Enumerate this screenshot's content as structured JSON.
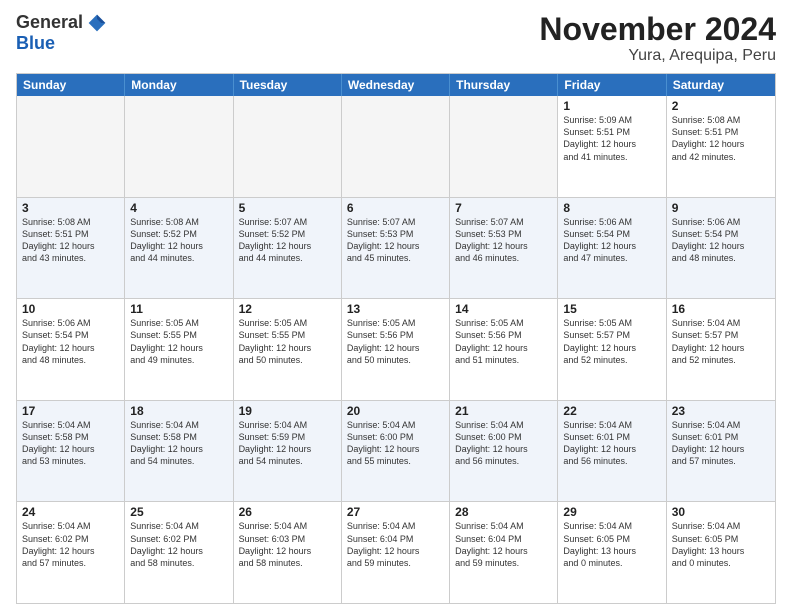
{
  "logo": {
    "general": "General",
    "blue": "Blue"
  },
  "title": "November 2024",
  "location": "Yura, Arequipa, Peru",
  "headers": [
    "Sunday",
    "Monday",
    "Tuesday",
    "Wednesday",
    "Thursday",
    "Friday",
    "Saturday"
  ],
  "rows": [
    [
      {
        "day": "",
        "empty": true
      },
      {
        "day": "",
        "empty": true
      },
      {
        "day": "",
        "empty": true
      },
      {
        "day": "",
        "empty": true
      },
      {
        "day": "",
        "empty": true
      },
      {
        "day": "1",
        "lines": [
          "Sunrise: 5:09 AM",
          "Sunset: 5:51 PM",
          "Daylight: 12 hours",
          "and 41 minutes."
        ]
      },
      {
        "day": "2",
        "lines": [
          "Sunrise: 5:08 AM",
          "Sunset: 5:51 PM",
          "Daylight: 12 hours",
          "and 42 minutes."
        ]
      }
    ],
    [
      {
        "day": "3",
        "lines": [
          "Sunrise: 5:08 AM",
          "Sunset: 5:51 PM",
          "Daylight: 12 hours",
          "and 43 minutes."
        ]
      },
      {
        "day": "4",
        "lines": [
          "Sunrise: 5:08 AM",
          "Sunset: 5:52 PM",
          "Daylight: 12 hours",
          "and 44 minutes."
        ]
      },
      {
        "day": "5",
        "lines": [
          "Sunrise: 5:07 AM",
          "Sunset: 5:52 PM",
          "Daylight: 12 hours",
          "and 44 minutes."
        ]
      },
      {
        "day": "6",
        "lines": [
          "Sunrise: 5:07 AM",
          "Sunset: 5:53 PM",
          "Daylight: 12 hours",
          "and 45 minutes."
        ]
      },
      {
        "day": "7",
        "lines": [
          "Sunrise: 5:07 AM",
          "Sunset: 5:53 PM",
          "Daylight: 12 hours",
          "and 46 minutes."
        ]
      },
      {
        "day": "8",
        "lines": [
          "Sunrise: 5:06 AM",
          "Sunset: 5:54 PM",
          "Daylight: 12 hours",
          "and 47 minutes."
        ]
      },
      {
        "day": "9",
        "lines": [
          "Sunrise: 5:06 AM",
          "Sunset: 5:54 PM",
          "Daylight: 12 hours",
          "and 48 minutes."
        ]
      }
    ],
    [
      {
        "day": "10",
        "lines": [
          "Sunrise: 5:06 AM",
          "Sunset: 5:54 PM",
          "Daylight: 12 hours",
          "and 48 minutes."
        ]
      },
      {
        "day": "11",
        "lines": [
          "Sunrise: 5:05 AM",
          "Sunset: 5:55 PM",
          "Daylight: 12 hours",
          "and 49 minutes."
        ]
      },
      {
        "day": "12",
        "lines": [
          "Sunrise: 5:05 AM",
          "Sunset: 5:55 PM",
          "Daylight: 12 hours",
          "and 50 minutes."
        ]
      },
      {
        "day": "13",
        "lines": [
          "Sunrise: 5:05 AM",
          "Sunset: 5:56 PM",
          "Daylight: 12 hours",
          "and 50 minutes."
        ]
      },
      {
        "day": "14",
        "lines": [
          "Sunrise: 5:05 AM",
          "Sunset: 5:56 PM",
          "Daylight: 12 hours",
          "and 51 minutes."
        ]
      },
      {
        "day": "15",
        "lines": [
          "Sunrise: 5:05 AM",
          "Sunset: 5:57 PM",
          "Daylight: 12 hours",
          "and 52 minutes."
        ]
      },
      {
        "day": "16",
        "lines": [
          "Sunrise: 5:04 AM",
          "Sunset: 5:57 PM",
          "Daylight: 12 hours",
          "and 52 minutes."
        ]
      }
    ],
    [
      {
        "day": "17",
        "lines": [
          "Sunrise: 5:04 AM",
          "Sunset: 5:58 PM",
          "Daylight: 12 hours",
          "and 53 minutes."
        ]
      },
      {
        "day": "18",
        "lines": [
          "Sunrise: 5:04 AM",
          "Sunset: 5:58 PM",
          "Daylight: 12 hours",
          "and 54 minutes."
        ]
      },
      {
        "day": "19",
        "lines": [
          "Sunrise: 5:04 AM",
          "Sunset: 5:59 PM",
          "Daylight: 12 hours",
          "and 54 minutes."
        ]
      },
      {
        "day": "20",
        "lines": [
          "Sunrise: 5:04 AM",
          "Sunset: 6:00 PM",
          "Daylight: 12 hours",
          "and 55 minutes."
        ]
      },
      {
        "day": "21",
        "lines": [
          "Sunrise: 5:04 AM",
          "Sunset: 6:00 PM",
          "Daylight: 12 hours",
          "and 56 minutes."
        ]
      },
      {
        "day": "22",
        "lines": [
          "Sunrise: 5:04 AM",
          "Sunset: 6:01 PM",
          "Daylight: 12 hours",
          "and 56 minutes."
        ]
      },
      {
        "day": "23",
        "lines": [
          "Sunrise: 5:04 AM",
          "Sunset: 6:01 PM",
          "Daylight: 12 hours",
          "and 57 minutes."
        ]
      }
    ],
    [
      {
        "day": "24",
        "lines": [
          "Sunrise: 5:04 AM",
          "Sunset: 6:02 PM",
          "Daylight: 12 hours",
          "and 57 minutes."
        ]
      },
      {
        "day": "25",
        "lines": [
          "Sunrise: 5:04 AM",
          "Sunset: 6:02 PM",
          "Daylight: 12 hours",
          "and 58 minutes."
        ]
      },
      {
        "day": "26",
        "lines": [
          "Sunrise: 5:04 AM",
          "Sunset: 6:03 PM",
          "Daylight: 12 hours",
          "and 58 minutes."
        ]
      },
      {
        "day": "27",
        "lines": [
          "Sunrise: 5:04 AM",
          "Sunset: 6:04 PM",
          "Daylight: 12 hours",
          "and 59 minutes."
        ]
      },
      {
        "day": "28",
        "lines": [
          "Sunrise: 5:04 AM",
          "Sunset: 6:04 PM",
          "Daylight: 12 hours",
          "and 59 minutes."
        ]
      },
      {
        "day": "29",
        "lines": [
          "Sunrise: 5:04 AM",
          "Sunset: 6:05 PM",
          "Daylight: 13 hours",
          "and 0 minutes."
        ]
      },
      {
        "day": "30",
        "lines": [
          "Sunrise: 5:04 AM",
          "Sunset: 6:05 PM",
          "Daylight: 13 hours",
          "and 0 minutes."
        ]
      }
    ]
  ]
}
